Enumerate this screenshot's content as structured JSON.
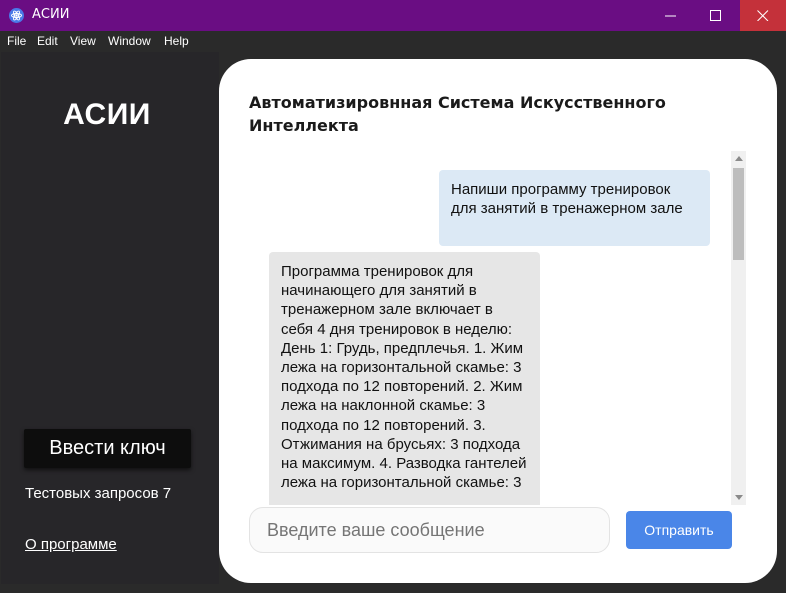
{
  "window": {
    "title": "АСИИ",
    "icon": "electron-atom-icon"
  },
  "menu": {
    "items": [
      "File",
      "Edit",
      "View",
      "Window",
      "Help"
    ]
  },
  "sidebar": {
    "logo": "АСИИ",
    "key_button": "Ввести ключ",
    "test_requests": "Тестовых запросов 7",
    "about_link": "О программе"
  },
  "chat": {
    "title": "Автоматизировнная Система Искусственного Интеллекта",
    "messages": [
      {
        "role": "user",
        "text": "Напиши программу тренировок для занятий в тренажерном зале"
      },
      {
        "role": "assistant",
        "text": "Программа тренировок для начинающего для занятий в тренажерном зале включает в себя 4 дня тренировок в неделю: День 1: Грудь, предплечья. 1. Жим лежа на горизонтальной скамье: 3 подхода по 12 повторений. 2. Жим лежа на наклонной скамье: 3 подхода по 12 повторений. 3. Отжимания на брусьях: 3 подхода на максимум. 4. Разводка гантелей лежа на горизонтальной скамье: 3"
      }
    ],
    "input": {
      "value": "",
      "placeholder": "Введите ваше сообщение"
    },
    "send_button": "Отправить"
  },
  "colors": {
    "titlebar": "#6a0d83",
    "sidebar": "#272629",
    "user_bubble": "#dce9f5",
    "bot_bubble": "#e6e6e6",
    "send_button": "#4a86e8",
    "close_button": "#c4313a"
  }
}
